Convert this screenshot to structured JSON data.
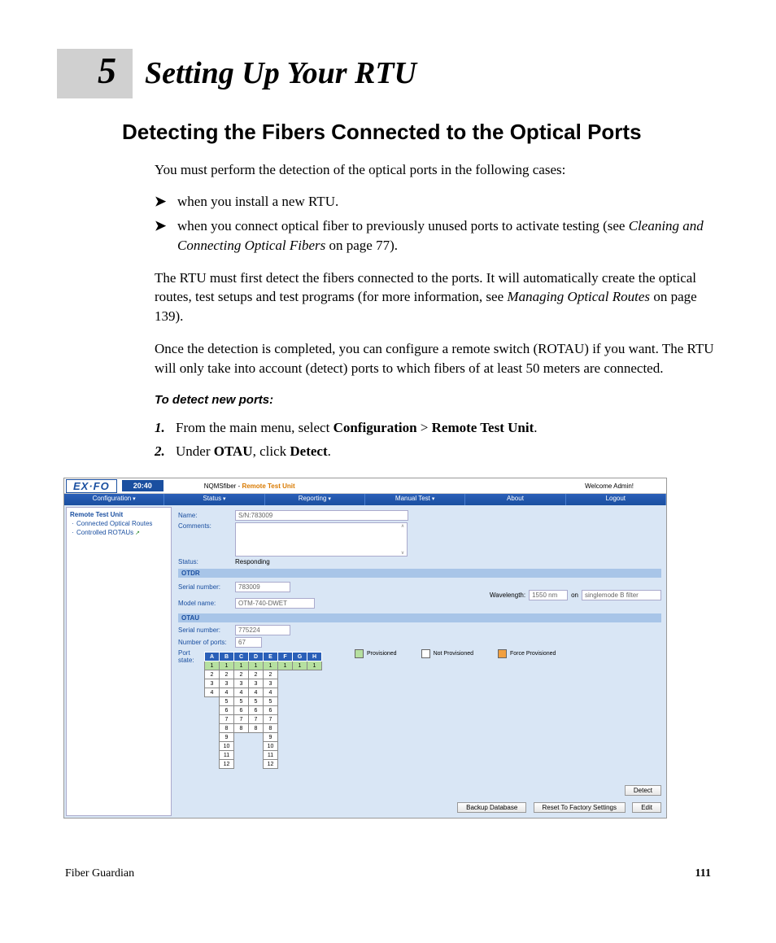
{
  "chapter": {
    "num": "5",
    "title": "Setting Up Your RTU"
  },
  "section_title": "Detecting the Fibers Connected to the Optical Ports",
  "intro": "You must perform the detection of the optical ports in the following cases:",
  "bullets": [
    "when you install a new RTU.",
    "when you connect optical fiber to previously unused ports to activate testing (see "
  ],
  "bullet1_ref": "Cleaning and Connecting Optical Fibers",
  "bullet1_tail": " on page 77).",
  "para2a": "The RTU must first detect the fibers connected to the ports. It will automatically create the optical routes, test setups and test programs (for more information, see ",
  "para2ref": "Managing Optical Routes",
  "para2b": " on page 139).",
  "para3": "Once the detection is completed, you can configure a remote switch (ROTAU) if you want. The RTU will only take into account (detect) ports to which fibers of at least 50 meters are connected.",
  "subhead": "To detect new ports:",
  "steps": {
    "s1a": "From the main menu, select ",
    "s1b": "Configuration",
    "s1c": " > ",
    "s1d": "Remote Test Unit",
    "s1e": ".",
    "s2a": "Under ",
    "s2b": "OTAU",
    "s2c": ", click ",
    "s2d": "Detect",
    "s2e": "."
  },
  "app": {
    "logo": "EX·FO",
    "time": "20:40",
    "title_prefix": "NQMSfiber - ",
    "title_page": "Remote Test Unit",
    "welcome": "Welcome Admin!",
    "menu": [
      "Configuration",
      "Status",
      "Reporting",
      "Manual Test",
      "About",
      "Logout"
    ],
    "side": {
      "top": "Remote Test Unit",
      "sub1": "Connected Optical Routes",
      "sub2": "Controlled ROTAUs"
    },
    "fields": {
      "name_label": "Name:",
      "name_value": "S/N:783009",
      "comments_label": "Comments:",
      "status_label": "Status:",
      "status_value": "Responding"
    },
    "otdr": {
      "header": "OTDR",
      "serial_label": "Serial number:",
      "serial_value": "783009",
      "model_label": "Model name:",
      "model_value": "OTM-740-DWET",
      "wavelength_label": "Wavelength:",
      "wavelength_value": "1550 nm",
      "on": "on",
      "mode": "singlemode B filter"
    },
    "otau": {
      "header": "OTAU",
      "serial_label": "Serial number:",
      "serial_value": "775224",
      "ports_label": "Number of ports:",
      "ports_value": "67",
      "port_state_label": "Port state:",
      "cols": [
        "A",
        "B",
        "C",
        "D",
        "E",
        "F",
        "G",
        "H"
      ],
      "rows": [
        [
          "1",
          "1",
          "1",
          "1",
          "1",
          "1",
          "1",
          "1"
        ],
        [
          "2",
          "2",
          "2",
          "2",
          "2",
          "",
          "",
          ""
        ],
        [
          "3",
          "3",
          "3",
          "3",
          "3",
          "",
          "",
          ""
        ],
        [
          "4",
          "4",
          "4",
          "4",
          "4",
          "",
          "",
          ""
        ],
        [
          "",
          "5",
          "5",
          "5",
          "5",
          "",
          "",
          ""
        ],
        [
          "",
          "6",
          "6",
          "6",
          "6",
          "",
          "",
          ""
        ],
        [
          "",
          "7",
          "7",
          "7",
          "7",
          "",
          "",
          ""
        ],
        [
          "",
          "8",
          "8",
          "8",
          "8",
          "",
          "",
          ""
        ],
        [
          "",
          "9",
          "",
          "",
          "9",
          "",
          "",
          ""
        ],
        [
          "",
          "10",
          "",
          "",
          "10",
          "",
          "",
          ""
        ],
        [
          "",
          "11",
          "",
          "",
          "11",
          "",
          "",
          ""
        ],
        [
          "",
          "12",
          "",
          "",
          "12",
          "",
          "",
          ""
        ]
      ],
      "prov_cells": {
        "0": [
          0,
          1,
          2,
          3,
          4,
          5,
          6,
          7
        ]
      },
      "legend": {
        "prov": "Provisioned",
        "notprov": "Not Provisioned",
        "force": "Force Provisioned"
      },
      "detect_btn": "Detect"
    },
    "footer_btns": [
      "Backup Database",
      "Reset To Factory Settings",
      "Edit"
    ]
  },
  "footer": {
    "product": "Fiber Guardian",
    "page": "111"
  }
}
